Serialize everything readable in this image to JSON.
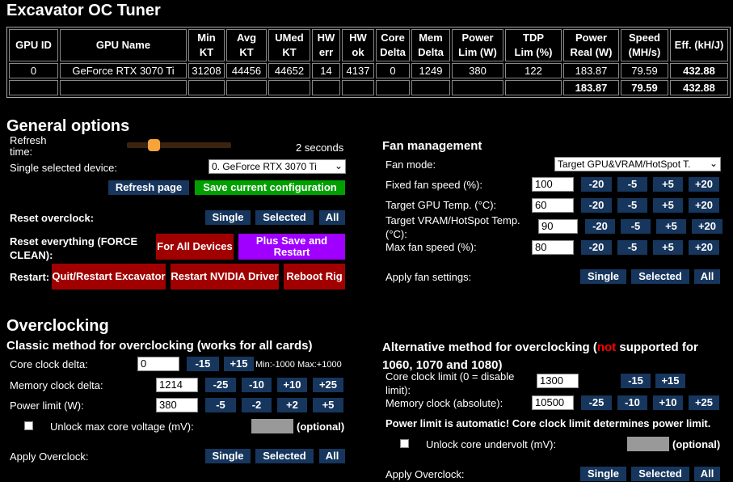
{
  "app": {
    "title": "Excavator OC Tuner"
  },
  "table": {
    "headers": [
      [
        "GPU ID"
      ],
      [
        "GPU Name"
      ],
      [
        "Min",
        "KT"
      ],
      [
        "Avg",
        "KT"
      ],
      [
        "UMed",
        "KT"
      ],
      [
        "HW",
        "err"
      ],
      [
        "HW",
        "ok"
      ],
      [
        "Core",
        "Delta"
      ],
      [
        "Mem",
        "Delta"
      ],
      [
        "Power",
        "Lim (W)"
      ],
      [
        "TDP",
        "Lim (%)"
      ],
      [
        "Power",
        "Real (W)"
      ],
      [
        "Speed",
        "(MH/s)"
      ],
      [
        "Eff. (kH/J)"
      ]
    ],
    "row": [
      "0",
      "GeForce RTX 3070 Ti",
      "31208",
      "44456",
      "44652",
      "14",
      "4137",
      "0",
      "1249",
      "380",
      "122",
      "183.87",
      "79.59",
      "432.88"
    ],
    "total": [
      "",
      "",
      "",
      "",
      "",
      "",
      "",
      "",
      "",
      "",
      "",
      "183.87",
      "79.59",
      "432.88"
    ]
  },
  "general": {
    "heading": "General options",
    "refresh_label": "Refresh time:",
    "refresh_value": "2 seconds",
    "refresh_level": 0.26,
    "device_label": "Single selected device:",
    "device_value": "0. GeForce RTX 3070 Ti",
    "refresh_page": "Refresh page",
    "save_config": "Save current configuration",
    "reset_oc_label": "Reset overclock:",
    "reset_all_label": "Reset everything (FORCE CLEAN):",
    "restart_label": "Restart:",
    "single": "Single",
    "selected": "Selected",
    "all": "All",
    "for_all_devices": "For All Devices",
    "plus_save_restart": "Plus Save and Restart",
    "quit_restart": "Quit/Restart Excavator",
    "restart_driver": "Restart NVIDIA Driver",
    "reboot_rig": "Reboot Rig"
  },
  "fan": {
    "heading": "Fan management",
    "mode_label": "Fan mode:",
    "mode_value": "Target GPU&VRAM/HotSpot T.",
    "fixed_label": "Fixed fan speed (%):",
    "fixed_value": "100",
    "gpu_temp_label": "Target GPU Temp. (°C):",
    "gpu_temp_value": "60",
    "vram_label": "Target VRAM/HotSpot Temp. (°C):",
    "vram_value": "90",
    "max_label": "Max fan speed (%):",
    "max_value": "80",
    "steps": [
      "-20",
      "-5",
      "+5",
      "+20"
    ],
    "apply_label": "Apply fan settings:"
  },
  "oc": {
    "heading": "Overclocking",
    "classic_heading": "Classic method for overclocking (works for all cards)",
    "core_label": "Core clock delta:",
    "core_value": "0",
    "core_steps": [
      "-15",
      "+15"
    ],
    "core_range": "Min:-1000 Max:+1000",
    "mem_label": "Memory clock delta:",
    "mem_value": "1214",
    "mem_steps": [
      "-25",
      "-10",
      "+10",
      "+25"
    ],
    "power_label": "Power limit (W):",
    "power_value": "380",
    "power_steps": [
      "-5",
      "-2",
      "+2",
      "+5"
    ],
    "unlock_label": "Unlock max core voltage (mV):",
    "optional": "(optional)",
    "apply_label": "Apply Overclock:"
  },
  "alt": {
    "heading_pre": "Alternative method for overclocking (",
    "heading_not": "not",
    "heading_post": " supported for 1060, 1070 and 1080)",
    "core_label": "Core clock limit (0 = disable limit):",
    "core_value": "1300",
    "core_steps": [
      "-15",
      "+15"
    ],
    "mem_label": "Memory clock (absolute):",
    "mem_value": "10500",
    "mem_steps": [
      "-25",
      "-10",
      "+10",
      "+25"
    ],
    "power_note": "Power limit is automatic! Core clock limit determines power limit.",
    "undervolt_label": "Unlock core undervolt (mV):",
    "optional": "(optional)",
    "apply_label": "Apply Overclock:"
  }
}
